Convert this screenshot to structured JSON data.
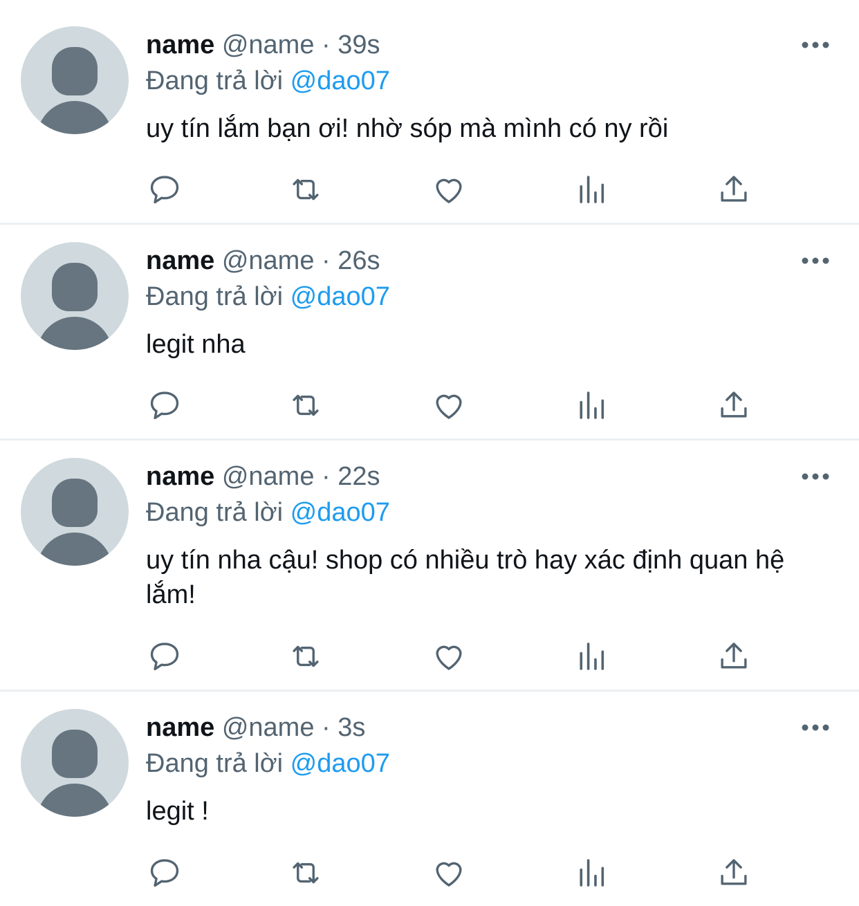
{
  "icons": {
    "reply": "speech-bubble-icon",
    "retweet": "retweet-arrows-icon",
    "like": "heart-icon",
    "views": "bar-chart-icon",
    "share": "upload-arrow-icon",
    "more": "ellipsis-icon"
  },
  "colors": {
    "link": "#1d9bf0",
    "secondary_text": "#536471",
    "primary_text": "#0f1419",
    "avatar_bg": "#cfd9de",
    "avatar_fg": "#66757f",
    "divider": "#eceff1"
  },
  "tweets": [
    {
      "display_name": "name",
      "handle": "@name",
      "separator": "·",
      "time": "39s",
      "reply_prefix": "Đang trả lời",
      "reply_to": "@dao07",
      "text": "uy tín lắm bạn ơi! nhờ sóp mà mình có ny rồi"
    },
    {
      "display_name": "name",
      "handle": "@name",
      "separator": "·",
      "time": "26s",
      "reply_prefix": "Đang trả lời",
      "reply_to": "@dao07",
      "text": "legit nha"
    },
    {
      "display_name": "name",
      "handle": "@name",
      "separator": "·",
      "time": "22s",
      "reply_prefix": "Đang trả lời",
      "reply_to": "@dao07",
      "text": "uy tín nha cậu! shop có nhiều trò hay xác định quan hệ lắm!"
    },
    {
      "display_name": "name",
      "handle": "@name",
      "separator": "·",
      "time": "3s",
      "reply_prefix": "Đang trả lời",
      "reply_to": "@dao07",
      "text": "legit !"
    }
  ]
}
